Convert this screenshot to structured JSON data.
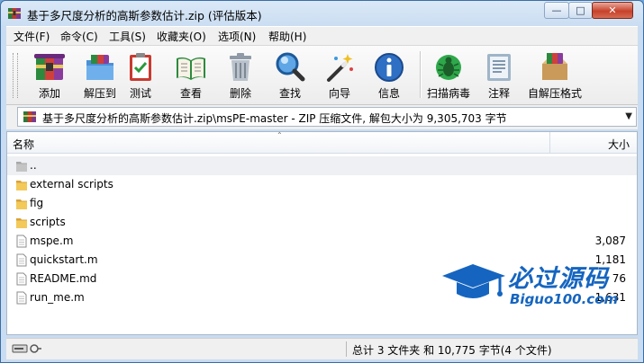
{
  "window": {
    "title": "基于多尺度分析的高斯参数估计.zip (评估版本)",
    "minimize_glyph": "—",
    "maximize_glyph": "□",
    "close_glyph": "✕"
  },
  "menu": [
    "文件(F)",
    "命令(C)",
    "工具(S)",
    "收藏夹(O)",
    "选项(N)",
    "帮助(H)"
  ],
  "toolbar": [
    {
      "label": "添加",
      "icon": "add-archive-icon"
    },
    {
      "label": "解压到",
      "icon": "extract-to-icon"
    },
    {
      "label": "测试",
      "icon": "test-icon"
    },
    {
      "label": "查看",
      "icon": "view-icon"
    },
    {
      "label": "删除",
      "icon": "delete-icon"
    },
    {
      "label": "查找",
      "icon": "find-icon"
    },
    {
      "label": "向导",
      "icon": "wizard-icon"
    },
    {
      "label": "信息",
      "icon": "info-icon"
    },
    {
      "label": "扫描病毒",
      "icon": "virus-scan-icon"
    },
    {
      "label": "注释",
      "icon": "comment-icon"
    },
    {
      "label": "自解压格式",
      "icon": "sfx-icon"
    }
  ],
  "address": {
    "path": "基于多尺度分析的高斯参数估计.zip\\msPE-master - ZIP 压缩文件, 解包大小为 9,305,703 字节",
    "dropdown_glyph": "▼"
  },
  "columns": {
    "name": "名称",
    "size": "大小",
    "sort_glyph": "⌃"
  },
  "files": [
    {
      "name": "..",
      "size": "",
      "type": "up"
    },
    {
      "name": "external scripts",
      "size": "",
      "type": "folder"
    },
    {
      "name": "fig",
      "size": "",
      "type": "folder"
    },
    {
      "name": "scripts",
      "size": "",
      "type": "folder"
    },
    {
      "name": "mspe.m",
      "size": "3,087",
      "type": "file"
    },
    {
      "name": "quickstart.m",
      "size": "1,181",
      "type": "file"
    },
    {
      "name": "README.md",
      "size": "76",
      "type": "file"
    },
    {
      "name": "run_me.m",
      "size": "1,631",
      "type": "file"
    }
  ],
  "watermark": {
    "cn": "必过源码",
    "en": "Biguo100.com"
  },
  "status": {
    "summary": "总计 3 文件夹 和 10,775 字节(4 个文件)"
  },
  "colors": {
    "accent": "#1565c0",
    "folder": "#e8b84a",
    "close": "#c7412a"
  }
}
